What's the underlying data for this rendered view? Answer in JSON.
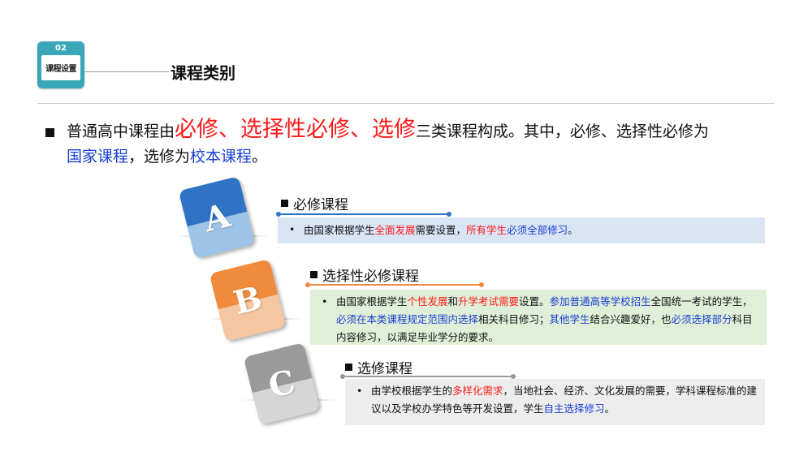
{
  "header": {
    "badge_number": "02",
    "badge_label": "课程设置",
    "title": "课程类别"
  },
  "intro": {
    "p1": "普通高中课程由",
    "h1": "必修、选择性必修、选修",
    "p2": "三类课程构成。其中，必修、选择性必修为",
    "b1": "国家课程",
    "p3": "，选修为",
    "b2": "校本课程",
    "p4": "。"
  },
  "cards": [
    {
      "letter": "A",
      "color_top": "#2f73c4",
      "color_bottom": "#9dc4e6"
    },
    {
      "letter": "B",
      "color_top": "#f08a3c",
      "color_bottom": "#f6c6a1"
    },
    {
      "letter": "C",
      "color_top": "#9a9a9a",
      "color_bottom": "#d6d6d6"
    }
  ],
  "sections": [
    {
      "heading": "必修课程",
      "accent": "#2f73c4",
      "bullet": "•",
      "text": [
        {
          "t": "由国家根据学生",
          "c": ""
        },
        {
          "t": "全面发展",
          "c": "red"
        },
        {
          "t": "需要设置，",
          "c": ""
        },
        {
          "t": "所有学生",
          "c": "red"
        },
        {
          "t": "必须全部修习",
          "c": "blue"
        },
        {
          "t": "。",
          "c": ""
        }
      ]
    },
    {
      "heading": "选择性必修课程",
      "accent": "#f08a3c",
      "bullet": "•",
      "text": [
        {
          "t": "由国家根据学生",
          "c": ""
        },
        {
          "t": "个性发展",
          "c": "red"
        },
        {
          "t": "和",
          "c": ""
        },
        {
          "t": "升学考试需要",
          "c": "red"
        },
        {
          "t": "设置。",
          "c": ""
        },
        {
          "t": "参加普通高等学校招生",
          "c": "blue"
        },
        {
          "t": "全国统一考试的学生，",
          "c": ""
        },
        {
          "t": "必须在本类课程规定范围内选择",
          "c": "blue"
        },
        {
          "t": "相关科目修习；",
          "c": ""
        },
        {
          "t": "其他学生",
          "c": "blue"
        },
        {
          "t": "结合兴趣爱好，也",
          "c": ""
        },
        {
          "t": "必须选择部分",
          "c": "blue"
        },
        {
          "t": "科目内容修习，以满足毕业学分的要求。",
          "c": ""
        }
      ]
    },
    {
      "heading": "选修课程",
      "accent": "#9a9a9a",
      "bullet": "•",
      "text": [
        {
          "t": "由学校根据学生的",
          "c": ""
        },
        {
          "t": "多样化需求",
          "c": "red"
        },
        {
          "t": "，当地社会、经济、文化发展的需要，学科课程标准的建议以及学校办学特色等开发设置，学生",
          "c": ""
        },
        {
          "t": "自主选择修习",
          "c": "blue"
        },
        {
          "t": "。",
          "c": ""
        }
      ]
    }
  ]
}
